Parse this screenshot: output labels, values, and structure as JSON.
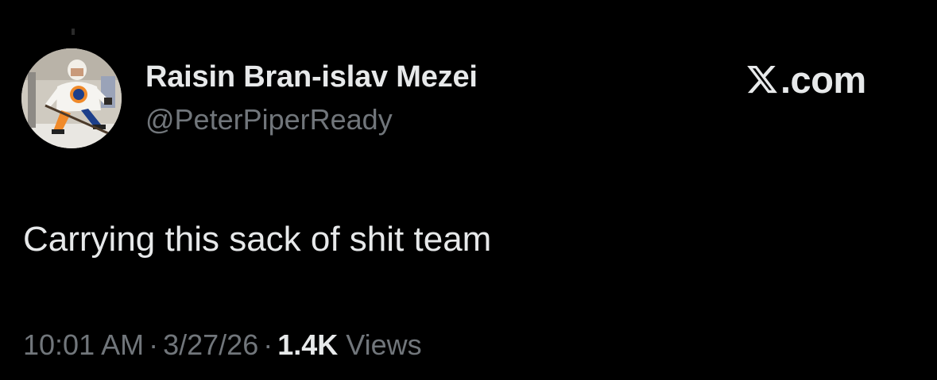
{
  "author": {
    "display_name": "Raisin Bran-islav Mezei",
    "handle": "@PeterPiperReady",
    "avatar_description": "hockey-player-avatar"
  },
  "brand": {
    "label": ".com",
    "icon": "x-logo-icon"
  },
  "tweet": {
    "text": "Carrying this sack of shit team"
  },
  "meta": {
    "time": "10:01 AM",
    "separator": "·",
    "date": "3/27/26",
    "views_count": "1.4K",
    "views_label": "Views"
  },
  "colors": {
    "background": "#000000",
    "primary_text": "#e7e9ea",
    "secondary_text": "#71767b"
  }
}
